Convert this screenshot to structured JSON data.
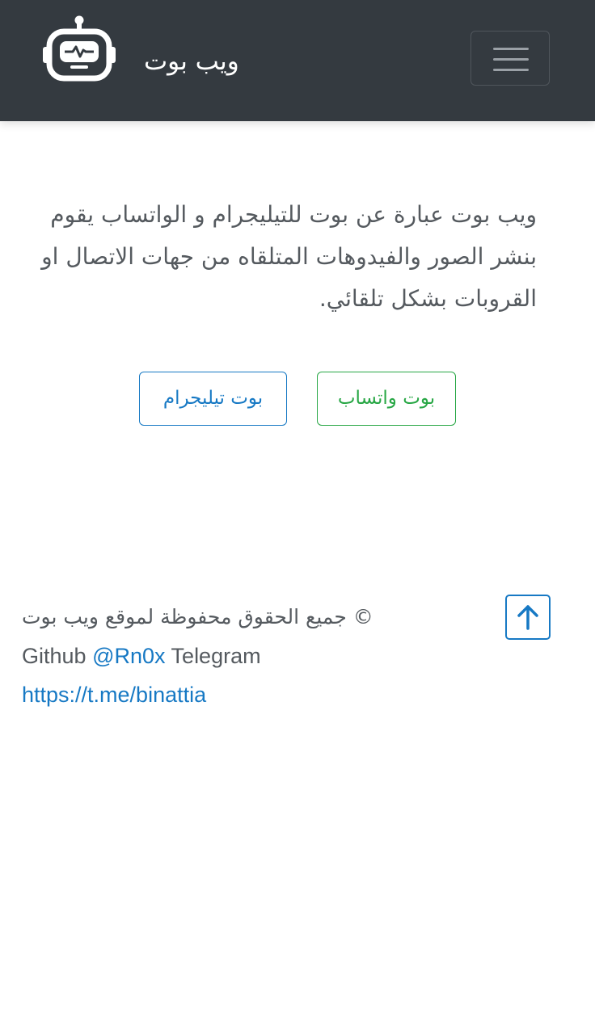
{
  "navbar": {
    "brand_name": "ويب بوت",
    "brand_icon": "robot-icon",
    "menu_icon": "hamburger-menu-icon"
  },
  "intro": {
    "text": "ويب بوت عبارة عن بوت للتيليجرام و الواتساب يقوم بنشر الصور والفيدوهات المتلقاه من جهات الاتصال او القروبات بشكل تلقائي."
  },
  "buttons": {
    "whatsapp": "بوت واتساب",
    "telegram": "بوت تيليجرام"
  },
  "footer": {
    "copyright": "© جميع الحقوق محفوظة لموقع ويب بوت",
    "github_label": "Github",
    "github_handle": "@Rn0x",
    "telegram_label": "Telegram",
    "telegram_link": "https://t.me/binattia",
    "to_top_icon": "arrow-up-icon"
  },
  "colors": {
    "navbar_bg": "#343a40",
    "success": "#28a745",
    "primary": "#1779c4",
    "text": "#555a5f"
  }
}
